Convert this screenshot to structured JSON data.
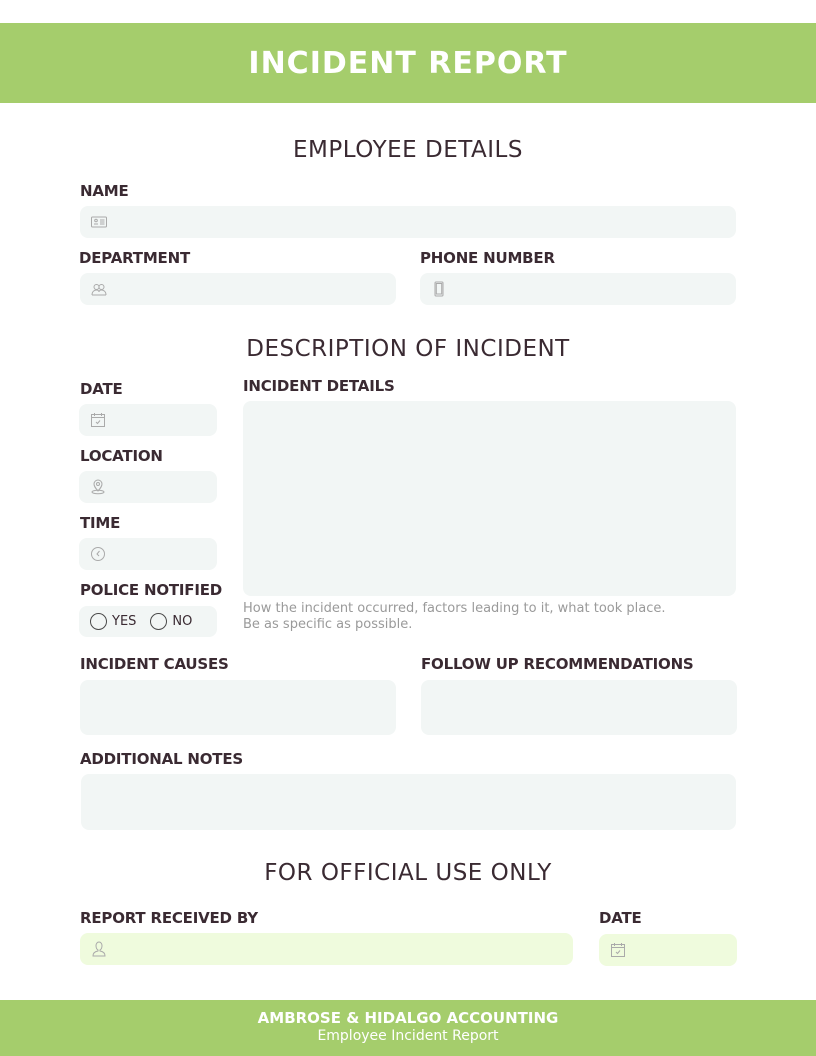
{
  "header": {
    "title": "INCIDENT REPORT",
    "color": "#a5cd6c"
  },
  "employee_details": {
    "title": "EMPLOYEE DETAILS",
    "name_label": "NAME",
    "name_value": "",
    "name_icon": "id-card-icon",
    "department_label": "DEPARTMENT",
    "department_value": "",
    "department_icon": "people-icon",
    "phone_label": "PHONE NUMBER",
    "phone_value": "",
    "phone_icon": "mobile-phone-icon"
  },
  "incident": {
    "title": "DESCRIPTION OF INCIDENT",
    "date_label": "DATE",
    "date_icon": "calendar-icon",
    "location_label": "LOCATION",
    "location_icon": "map-pin-icon",
    "time_label": "TIME",
    "time_icon": "clock-icon",
    "police_label": "POLICE NOTIFIED",
    "police_options": [
      "YES",
      "NO"
    ],
    "details_label": "INCIDENT DETAILS",
    "details_value": "",
    "details_hint_line1": "How the incident occurred, factors leading to it, what took place.",
    "details_hint_line2": "Be as specific as possible.",
    "causes_label": "INCIDENT CAUSES",
    "followup_label": "FOLLOW UP RECOMMENDATIONS",
    "notes_label": "ADDITIONAL NOTES"
  },
  "official": {
    "title": "FOR OFFICIAL USE ONLY",
    "received_label": "REPORT RECEIVED BY",
    "received_icon": "user-icon",
    "date_label": "DATE",
    "date_icon": "calendar-icon"
  },
  "footer": {
    "company": "AMBROSE & HIDALGO ACCOUNTING",
    "subtitle": "Employee Incident Report"
  }
}
